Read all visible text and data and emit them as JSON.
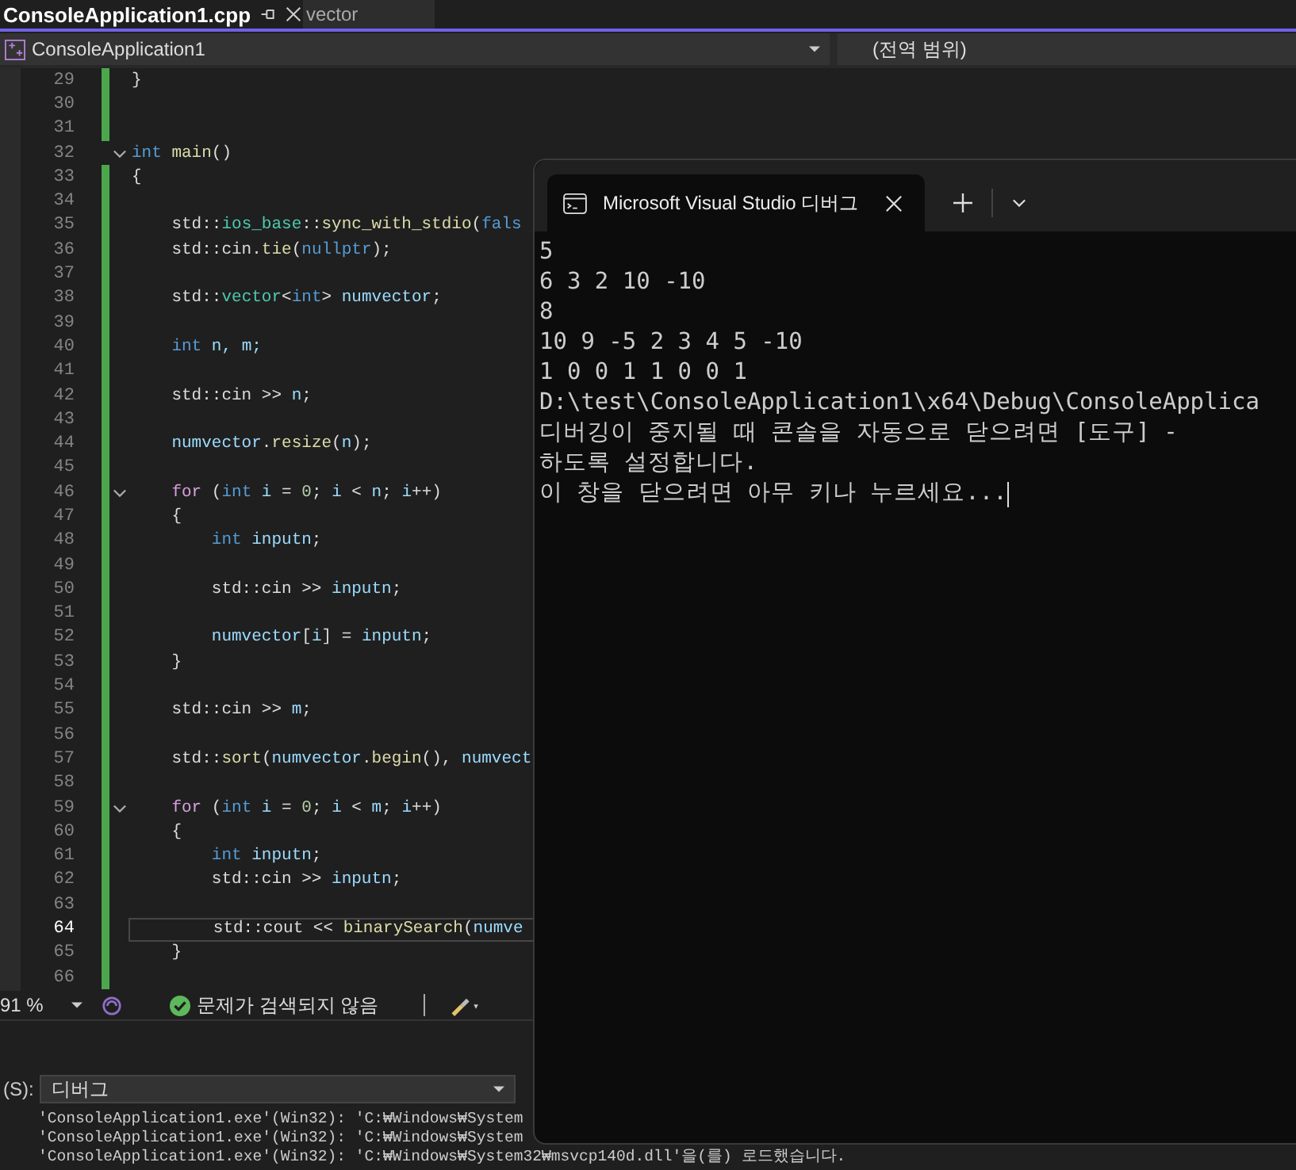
{
  "editor_tabs": [
    {
      "label": "ConsoleApplication1.cpp",
      "selected": true
    },
    {
      "label": "vector",
      "selected": false
    }
  ],
  "navigation_bar": {
    "project": "ConsoleApplication1",
    "scope": "(전역 범위)"
  },
  "code_lines": [
    {
      "number": "29",
      "changed": true,
      "collapsible": false,
      "current": false,
      "tokens": [
        {
          "text": "}",
          "kind": "plain"
        }
      ]
    },
    {
      "number": "30",
      "changed": true,
      "collapsible": false,
      "current": false
    },
    {
      "number": "31",
      "changed": true,
      "collapsible": false,
      "current": false
    },
    {
      "number": "32",
      "changed": false,
      "collapsible": true,
      "current": false,
      "tokens": [
        {
          "text": "int",
          "kind": "keyword"
        },
        {
          "text": " main",
          "kind": "function"
        },
        {
          "text": "()",
          "kind": "plain"
        }
      ]
    },
    {
      "number": "33",
      "changed": true,
      "collapsible": false,
      "current": false,
      "tokens": [
        {
          "text": "{",
          "kind": "plain"
        }
      ]
    },
    {
      "number": "34",
      "changed": true,
      "collapsible": false,
      "current": false
    },
    {
      "number": "35",
      "changed": true,
      "collapsible": false,
      "current": false,
      "tokens": [
        {
          "text": "    std::",
          "kind": "plain"
        },
        {
          "text": "ios_base",
          "kind": "type"
        },
        {
          "text": "::",
          "kind": "plain"
        },
        {
          "text": "sync_with_stdio",
          "kind": "function"
        },
        {
          "text": "(",
          "kind": "plain"
        },
        {
          "text": "fals",
          "kind": "keyword"
        }
      ]
    },
    {
      "number": "36",
      "changed": true,
      "collapsible": false,
      "current": false,
      "tokens": [
        {
          "text": "    std::cin.",
          "kind": "plain"
        },
        {
          "text": "tie",
          "kind": "function"
        },
        {
          "text": "(",
          "kind": "plain"
        },
        {
          "text": "nullptr",
          "kind": "keyword"
        },
        {
          "text": ");",
          "kind": "plain"
        }
      ]
    },
    {
      "number": "37",
      "changed": true,
      "collapsible": false,
      "current": false
    },
    {
      "number": "38",
      "changed": true,
      "collapsible": false,
      "current": false,
      "tokens": [
        {
          "text": "    std::",
          "kind": "plain"
        },
        {
          "text": "vector",
          "kind": "type"
        },
        {
          "text": "<",
          "kind": "plain"
        },
        {
          "text": "int",
          "kind": "keyword"
        },
        {
          "text": "> ",
          "kind": "plain"
        },
        {
          "text": "numvector",
          "kind": "variable"
        },
        {
          "text": ";",
          "kind": "plain"
        }
      ]
    },
    {
      "number": "39",
      "changed": true,
      "collapsible": false,
      "current": false
    },
    {
      "number": "40",
      "changed": true,
      "collapsible": false,
      "current": false,
      "tokens": [
        {
          "text": "    int",
          "kind": "keyword"
        },
        {
          "text": " n, m;",
          "kind": "variable"
        }
      ]
    },
    {
      "number": "41",
      "changed": true,
      "collapsible": false,
      "current": false
    },
    {
      "number": "42",
      "changed": true,
      "collapsible": false,
      "current": false,
      "tokens": [
        {
          "text": "    std::cin >> ",
          "kind": "plain"
        },
        {
          "text": "n",
          "kind": "variable"
        },
        {
          "text": ";",
          "kind": "plain"
        }
      ]
    },
    {
      "number": "43",
      "changed": true,
      "collapsible": false,
      "current": false
    },
    {
      "number": "44",
      "changed": true,
      "collapsible": false,
      "current": false,
      "tokens": [
        {
          "text": "    numvector",
          "kind": "variable"
        },
        {
          "text": ".",
          "kind": "plain"
        },
        {
          "text": "resize",
          "kind": "function"
        },
        {
          "text": "(",
          "kind": "plain"
        },
        {
          "text": "n",
          "kind": "variable"
        },
        {
          "text": ");",
          "kind": "plain"
        }
      ]
    },
    {
      "number": "45",
      "changed": true,
      "collapsible": false,
      "current": false
    },
    {
      "number": "46",
      "changed": true,
      "collapsible": true,
      "current": false,
      "tokens": [
        {
          "text": "    for",
          "kind": "control"
        },
        {
          "text": " (",
          "kind": "plain"
        },
        {
          "text": "int",
          "kind": "keyword"
        },
        {
          "text": " i",
          "kind": "variable"
        },
        {
          "text": " = ",
          "kind": "plain"
        },
        {
          "text": "0",
          "kind": "number"
        },
        {
          "text": "; ",
          "kind": "plain"
        },
        {
          "text": "i",
          "kind": "variable"
        },
        {
          "text": " < ",
          "kind": "plain"
        },
        {
          "text": "n",
          "kind": "variable"
        },
        {
          "text": "; ",
          "kind": "plain"
        },
        {
          "text": "i",
          "kind": "variable"
        },
        {
          "text": "++)",
          "kind": "plain"
        }
      ]
    },
    {
      "number": "47",
      "changed": true,
      "collapsible": false,
      "current": false,
      "tokens": [
        {
          "text": "    {",
          "kind": "plain"
        }
      ]
    },
    {
      "number": "48",
      "changed": true,
      "collapsible": false,
      "current": false,
      "tokens": [
        {
          "text": "        int",
          "kind": "keyword"
        },
        {
          "text": " inputn",
          "kind": "variable"
        },
        {
          "text": ";",
          "kind": "plain"
        }
      ]
    },
    {
      "number": "49",
      "changed": true,
      "collapsible": false,
      "current": false
    },
    {
      "number": "50",
      "changed": true,
      "collapsible": false,
      "current": false,
      "tokens": [
        {
          "text": "        std::cin >> ",
          "kind": "plain"
        },
        {
          "text": "inputn",
          "kind": "variable"
        },
        {
          "text": ";",
          "kind": "plain"
        }
      ]
    },
    {
      "number": "51",
      "changed": true,
      "collapsible": false,
      "current": false
    },
    {
      "number": "52",
      "changed": true,
      "collapsible": false,
      "current": false,
      "tokens": [
        {
          "text": "        numvector",
          "kind": "variable"
        },
        {
          "text": "[",
          "kind": "plain"
        },
        {
          "text": "i",
          "kind": "variable"
        },
        {
          "text": "] = ",
          "kind": "plain"
        },
        {
          "text": "inputn",
          "kind": "variable"
        },
        {
          "text": ";",
          "kind": "plain"
        }
      ]
    },
    {
      "number": "53",
      "changed": true,
      "collapsible": false,
      "current": false,
      "tokens": [
        {
          "text": "    }",
          "kind": "plain"
        }
      ]
    },
    {
      "number": "54",
      "changed": true,
      "collapsible": false,
      "current": false
    },
    {
      "number": "55",
      "changed": true,
      "collapsible": false,
      "current": false,
      "tokens": [
        {
          "text": "    std::cin >> ",
          "kind": "plain"
        },
        {
          "text": "m",
          "kind": "variable"
        },
        {
          "text": ";",
          "kind": "plain"
        }
      ]
    },
    {
      "number": "56",
      "changed": true,
      "collapsible": false,
      "current": false
    },
    {
      "number": "57",
      "changed": true,
      "collapsible": false,
      "current": false,
      "tokens": [
        {
          "text": "    std::",
          "kind": "plain"
        },
        {
          "text": "sort",
          "kind": "function"
        },
        {
          "text": "(",
          "kind": "plain"
        },
        {
          "text": "numvector",
          "kind": "variable"
        },
        {
          "text": ".",
          "kind": "plain"
        },
        {
          "text": "begin",
          "kind": "function"
        },
        {
          "text": "(), ",
          "kind": "plain"
        },
        {
          "text": "numvect",
          "kind": "variable"
        }
      ]
    },
    {
      "number": "58",
      "changed": true,
      "collapsible": false,
      "current": false
    },
    {
      "number": "59",
      "changed": true,
      "collapsible": true,
      "current": false,
      "tokens": [
        {
          "text": "    for",
          "kind": "control"
        },
        {
          "text": " (",
          "kind": "plain"
        },
        {
          "text": "int",
          "kind": "keyword"
        },
        {
          "text": " i",
          "kind": "variable"
        },
        {
          "text": " = ",
          "kind": "plain"
        },
        {
          "text": "0",
          "kind": "number"
        },
        {
          "text": "; ",
          "kind": "plain"
        },
        {
          "text": "i",
          "kind": "variable"
        },
        {
          "text": " < ",
          "kind": "plain"
        },
        {
          "text": "m",
          "kind": "variable"
        },
        {
          "text": "; ",
          "kind": "plain"
        },
        {
          "text": "i",
          "kind": "variable"
        },
        {
          "text": "++)",
          "kind": "plain"
        }
      ]
    },
    {
      "number": "60",
      "changed": true,
      "collapsible": false,
      "current": false,
      "tokens": [
        {
          "text": "    {",
          "kind": "plain"
        }
      ]
    },
    {
      "number": "61",
      "changed": true,
      "collapsible": false,
      "current": false,
      "tokens": [
        {
          "text": "        int",
          "kind": "keyword"
        },
        {
          "text": " inputn",
          "kind": "variable"
        },
        {
          "text": ";",
          "kind": "plain"
        }
      ]
    },
    {
      "number": "62",
      "changed": true,
      "collapsible": false,
      "current": false,
      "tokens": [
        {
          "text": "        std::cin >> ",
          "kind": "plain"
        },
        {
          "text": "inputn",
          "kind": "variable"
        },
        {
          "text": ";",
          "kind": "plain"
        }
      ]
    },
    {
      "number": "63",
      "changed": true,
      "collapsible": false,
      "current": false
    },
    {
      "number": "64",
      "changed": true,
      "collapsible": false,
      "current": true,
      "tokens": [
        {
          "text": "        std::cout << ",
          "kind": "plain"
        },
        {
          "text": "binarySearch",
          "kind": "function"
        },
        {
          "text": "(",
          "kind": "plain"
        },
        {
          "text": "numve",
          "kind": "variable"
        }
      ]
    },
    {
      "number": "65",
      "changed": true,
      "collapsible": false,
      "current": false,
      "tokens": [
        {
          "text": "    }",
          "kind": "plain"
        }
      ]
    },
    {
      "number": "66",
      "changed": true,
      "collapsible": false,
      "current": false
    }
  ],
  "status_bar": {
    "zoom": "91 %",
    "issues": "문제가 검색되지 않음"
  },
  "output_panel": {
    "source_label": "(S):",
    "source": "디버그",
    "lines": [
      "'ConsoleApplication1.exe'(Win32): 'C:₩Windows₩System",
      "'ConsoleApplication1.exe'(Win32): 'C:₩Windows₩System",
      "'ConsoleApplication1.exe'(Win32): 'C:₩Windows₩System32₩msvcp140d.dll'을(를) 로드했습니다."
    ]
  },
  "console_window": {
    "tab_title": "Microsoft Visual Studio 디버그",
    "lines": [
      "5",
      "6 3 2 10 -10",
      "8",
      "10 9 -5 2 3 4 5 -10",
      "1 0 0 1 1 0 0 1",
      "D:\\test\\ConsoleApplication1\\x64\\Debug\\ConsoleApplica",
      "디버깅이 중지될 때 콘솔을 자동으로 닫으려면 [도구] -",
      "하도록 설정합니다.",
      "이 창을 닫으려면 아무 키나 누르세요..."
    ]
  }
}
